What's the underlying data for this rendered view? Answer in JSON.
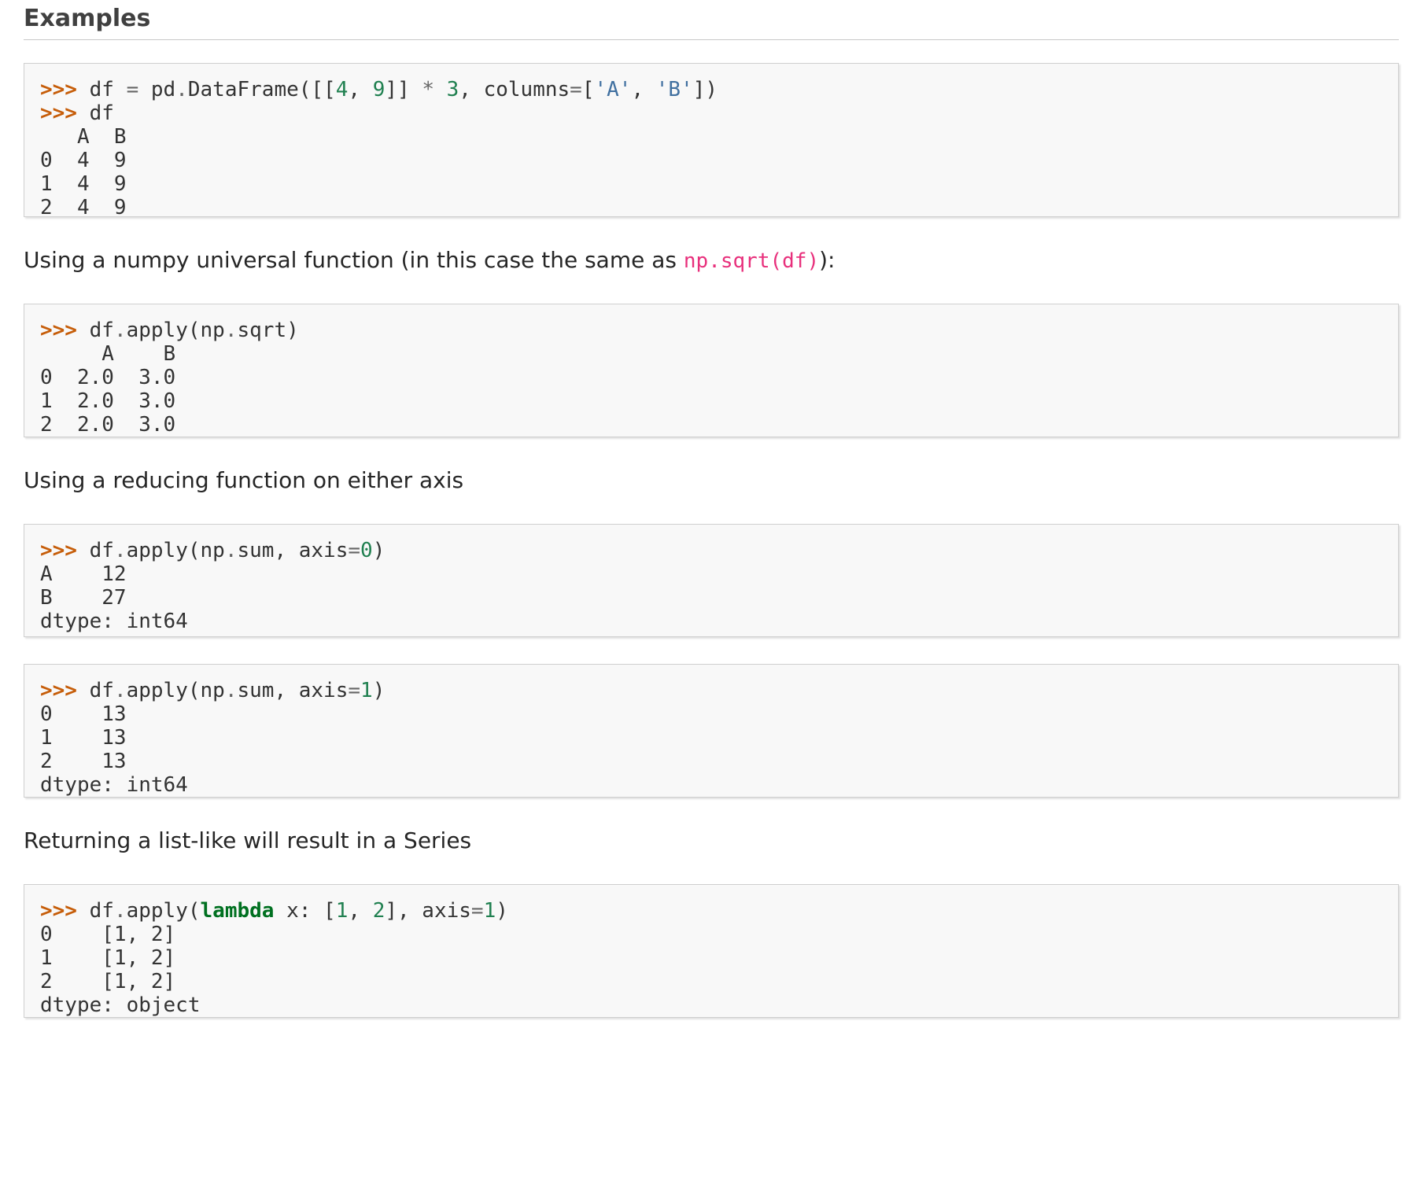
{
  "heading": "Examples",
  "paragraphs": {
    "p1_before": "Using a numpy universal function (in this case the same as ",
    "p1_code": "np.sqrt(df)",
    "p1_after": "):",
    "p2": "Using a reducing function on either axis",
    "p3": "Returning a list-like will result in a Series"
  },
  "code": {
    "prompt": ">>>",
    "b1": {
      "l1": {
        "a": "df ",
        "b": "=",
        "c": " pd",
        "d": ".",
        "e": "DataFrame([[",
        "f": "4",
        "g": ", ",
        "h": "9",
        "i": "]] ",
        "j": "*",
        "k": " ",
        "l": "3",
        "m": ", columns",
        "n": "=",
        "o": "[",
        "p": "'A'",
        "q": ", ",
        "r": "'B'",
        "s": "])"
      },
      "l2": "df",
      "out": "   A  B\n0  4  9\n1  4  9\n2  4  9"
    },
    "b2": {
      "l1": {
        "a": "df",
        "b": ".",
        "c": "apply(np",
        "d": ".",
        "e": "sqrt)"
      },
      "out": "     A    B\n0  2.0  3.0\n1  2.0  3.0\n2  2.0  3.0"
    },
    "b3": {
      "l1": {
        "a": "df",
        "b": ".",
        "c": "apply(np",
        "d": ".",
        "e": "sum, axis",
        "f": "=",
        "g": "0",
        "h": ")"
      },
      "out": "A    12\nB    27\ndtype: int64"
    },
    "b4": {
      "l1": {
        "a": "df",
        "b": ".",
        "c": "apply(np",
        "d": ".",
        "e": "sum, axis",
        "f": "=",
        "g": "1",
        "h": ")"
      },
      "out": "0    13\n1    13\n2    13\ndtype: int64"
    },
    "b5": {
      "l1": {
        "a": "df",
        "b": ".",
        "c": "apply(",
        "d": "lambda",
        "e": " x: [",
        "f": "1",
        "g": ", ",
        "h": "2",
        "i": "], axis",
        "j": "=",
        "k": "1",
        "l": ")"
      },
      "out": "0    [1, 2]\n1    [1, 2]\n2    [1, 2]\ndtype: object"
    }
  }
}
